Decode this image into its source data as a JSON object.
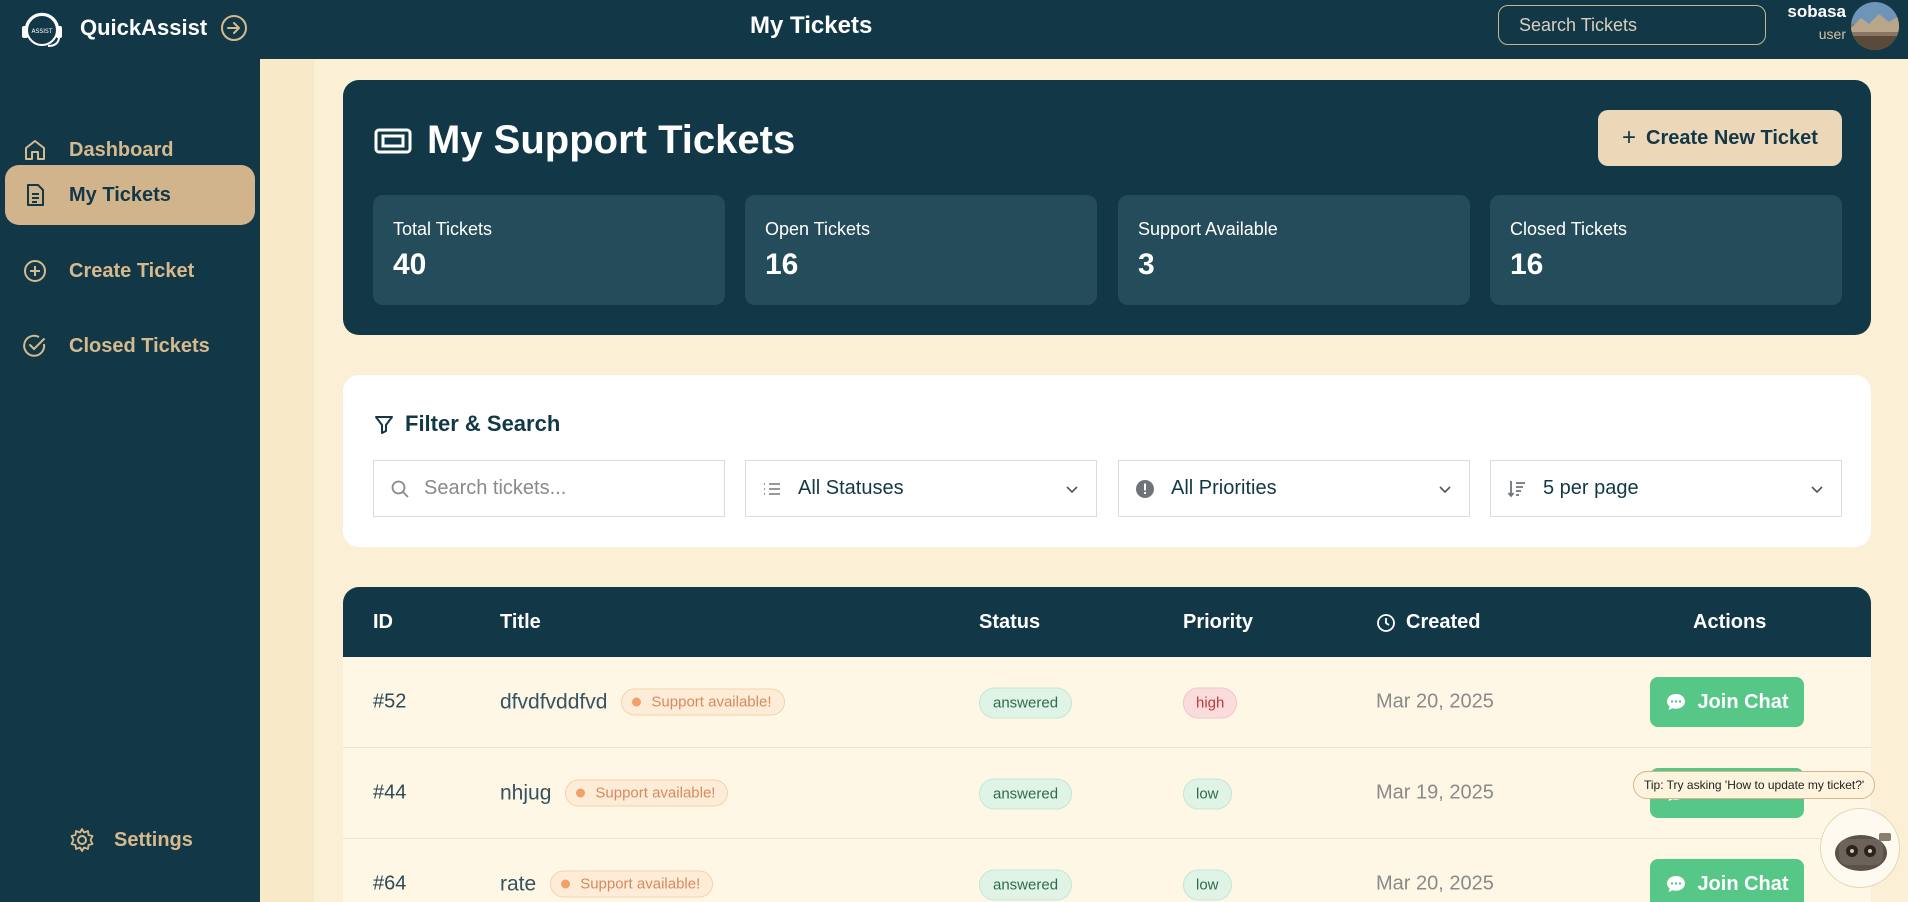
{
  "app": {
    "name": "QuickAssist",
    "logo_text": "ASSIST"
  },
  "header": {
    "title": "My Tickets",
    "search_placeholder": "Search Tickets"
  },
  "user": {
    "name": "sobasa",
    "role": "user"
  },
  "sidebar": {
    "items": [
      {
        "label": "Dashboard",
        "icon": "home-icon",
        "active": false
      },
      {
        "label": "My Tickets",
        "icon": "document-icon",
        "active": true
      },
      {
        "label": "Create Ticket",
        "icon": "plus-circle-icon",
        "active": false
      },
      {
        "label": "Closed Tickets",
        "icon": "check-circle-icon",
        "active": false
      }
    ],
    "settings_label": "Settings"
  },
  "hero": {
    "title": "My Support Tickets",
    "create_label": "Create New Ticket",
    "stats": [
      {
        "label": "Total Tickets",
        "value": "40"
      },
      {
        "label": "Open Tickets",
        "value": "16"
      },
      {
        "label": "Support Available",
        "value": "3"
      },
      {
        "label": "Closed Tickets",
        "value": "16"
      }
    ]
  },
  "filters": {
    "title": "Filter & Search",
    "search_placeholder": "Search tickets...",
    "status": "All Statuses",
    "priority": "All Priorities",
    "per_page": "5 per page"
  },
  "table": {
    "headers": {
      "id": "ID",
      "title": "Title",
      "status": "Status",
      "priority": "Priority",
      "created": "Created",
      "actions": "Actions"
    },
    "rows": [
      {
        "id": "#52",
        "title": "dfvdfvddfvd",
        "badge": "Support available!",
        "status": "answered",
        "priority": "high",
        "created": "Mar 20, 2025",
        "action": "Join Chat"
      },
      {
        "id": "#44",
        "title": "nhjug",
        "badge": "Support available!",
        "status": "answered",
        "priority": "low",
        "created": "Mar 19, 2025",
        "action": "Join Chat"
      },
      {
        "id": "#64",
        "title": "rate",
        "badge": "Support available!",
        "status": "answered",
        "priority": "low",
        "created": "Mar 20, 2025",
        "action": "Join Chat"
      }
    ]
  },
  "assistant": {
    "tip": "Tip: Try asking 'How to update my ticket?'"
  },
  "colors": {
    "primary": "#123847",
    "accent": "#d2b48c",
    "background": "#fbf0d6",
    "success": "#57c788",
    "danger": "#c0393b"
  }
}
